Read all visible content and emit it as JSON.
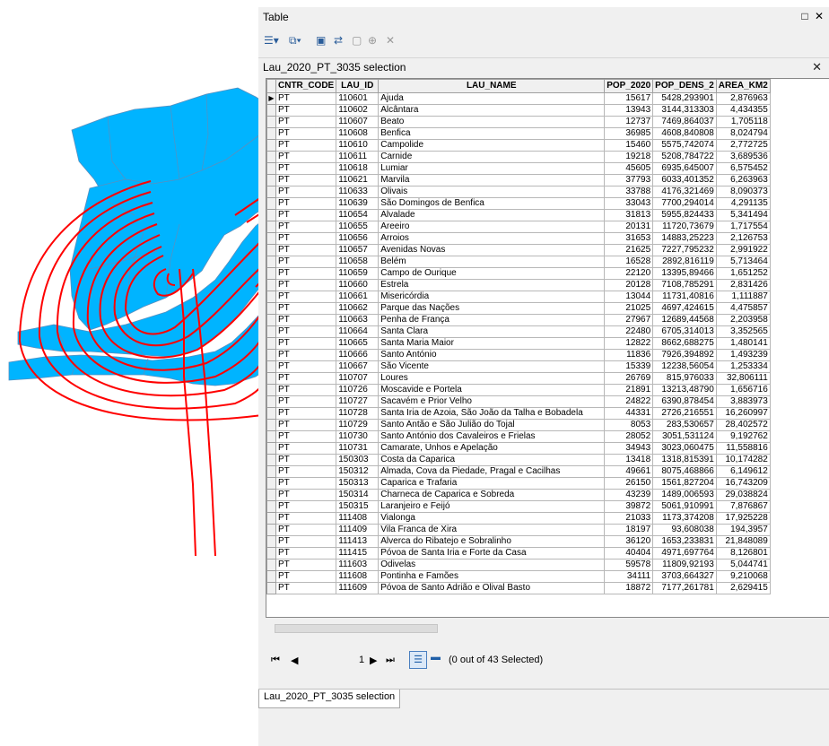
{
  "window": {
    "title": "Table",
    "close_glyph": "□ ✕"
  },
  "toolbar": {
    "icons": [
      "table-options-icon",
      "related-tables-icon",
      "select-by-attributes-icon",
      "switch-selection-icon",
      "clear-selection-icon",
      "zoom-to-selected-icon",
      "delete-selected-icon"
    ]
  },
  "tab": {
    "label": "Lau_2020_PT_3035 selection",
    "close": "✕"
  },
  "bottom_tab": {
    "label": "Lau_2020_PT_3035 selection"
  },
  "nav": {
    "first": "⏮",
    "prev": "◀",
    "current": "1",
    "next": "▶",
    "last": "⏭",
    "status": "(0 out of 43 Selected)"
  },
  "colors": {
    "map_fill": "#00b4ff",
    "contour": "#ff0000",
    "map_border": "#5a8fbf"
  },
  "table": {
    "columns": [
      "CNTR_CODE",
      "LAU_ID",
      "LAU_NAME",
      "POP_2020",
      "POP_DENS_2",
      "AREA_KM2"
    ],
    "rows": [
      [
        "PT",
        "110601",
        "Ajuda",
        "15617",
        "5428,293901",
        "2,876963"
      ],
      [
        "PT",
        "110602",
        "Alcântara",
        "13943",
        "3144,313303",
        "4,434355"
      ],
      [
        "PT",
        "110607",
        "Beato",
        "12737",
        "7469,864037",
        "1,705118"
      ],
      [
        "PT",
        "110608",
        "Benfica",
        "36985",
        "4608,840808",
        "8,024794"
      ],
      [
        "PT",
        "110610",
        "Campolide",
        "15460",
        "5575,742074",
        "2,772725"
      ],
      [
        "PT",
        "110611",
        "Carnide",
        "19218",
        "5208,784722",
        "3,689536"
      ],
      [
        "PT",
        "110618",
        "Lumiar",
        "45605",
        "6935,645007",
        "6,575452"
      ],
      [
        "PT",
        "110621",
        "Marvila",
        "37793",
        "6033,401352",
        "6,263963"
      ],
      [
        "PT",
        "110633",
        "Olivais",
        "33788",
        "4176,321469",
        "8,090373"
      ],
      [
        "PT",
        "110639",
        "São Domingos de Benfica",
        "33043",
        "7700,294014",
        "4,291135"
      ],
      [
        "PT",
        "110654",
        "Alvalade",
        "31813",
        "5955,824433",
        "5,341494"
      ],
      [
        "PT",
        "110655",
        "Areeiro",
        "20131",
        "11720,73679",
        "1,717554"
      ],
      [
        "PT",
        "110656",
        "Arroios",
        "31653",
        "14883,25223",
        "2,126753"
      ],
      [
        "PT",
        "110657",
        "Avenidas Novas",
        "21625",
        "7227,795232",
        "2,991922"
      ],
      [
        "PT",
        "110658",
        "Belém",
        "16528",
        "2892,816119",
        "5,713464"
      ],
      [
        "PT",
        "110659",
        "Campo de Ourique",
        "22120",
        "13395,89466",
        "1,651252"
      ],
      [
        "PT",
        "110660",
        "Estrela",
        "20128",
        "7108,785291",
        "2,831426"
      ],
      [
        "PT",
        "110661",
        "Misericórdia",
        "13044",
        "11731,40816",
        "1,111887"
      ],
      [
        "PT",
        "110662",
        "Parque das Nações",
        "21025",
        "4697,424615",
        "4,475857"
      ],
      [
        "PT",
        "110663",
        "Penha de França",
        "27967",
        "12689,44568",
        "2,203958"
      ],
      [
        "PT",
        "110664",
        "Santa Clara",
        "22480",
        "6705,314013",
        "3,352565"
      ],
      [
        "PT",
        "110665",
        "Santa Maria Maior",
        "12822",
        "8662,688275",
        "1,480141"
      ],
      [
        "PT",
        "110666",
        "Santo António",
        "11836",
        "7926,394892",
        "1,493239"
      ],
      [
        "PT",
        "110667",
        "São Vicente",
        "15339",
        "12238,56054",
        "1,253334"
      ],
      [
        "PT",
        "110707",
        "Loures",
        "26769",
        "815,976033",
        "32,806111"
      ],
      [
        "PT",
        "110726",
        "Moscavide e Portela",
        "21891",
        "13213,48790",
        "1,656716"
      ],
      [
        "PT",
        "110727",
        "Sacavém e Prior Velho",
        "24822",
        "6390,878454",
        "3,883973"
      ],
      [
        "PT",
        "110728",
        "Santa Iria de Azoia, São João da Talha e Bobadela",
        "44331",
        "2726,216551",
        "16,260997"
      ],
      [
        "PT",
        "110729",
        "Santo Antão e São Julião do Tojal",
        "8053",
        "283,530657",
        "28,402572"
      ],
      [
        "PT",
        "110730",
        "Santo António dos Cavaleiros e Frielas",
        "28052",
        "3051,531124",
        "9,192762"
      ],
      [
        "PT",
        "110731",
        "Camarate, Unhos e Apelação",
        "34943",
        "3023,060475",
        "11,558816"
      ],
      [
        "PT",
        "150303",
        "Costa da Caparica",
        "13418",
        "1318,815391",
        "10,174282"
      ],
      [
        "PT",
        "150312",
        "Almada, Cova da Piedade, Pragal e Cacilhas",
        "49661",
        "8075,468866",
        "6,149612"
      ],
      [
        "PT",
        "150313",
        "Caparica e Trafaria",
        "26150",
        "1561,827204",
        "16,743209"
      ],
      [
        "PT",
        "150314",
        "Charneca de Caparica e Sobreda",
        "43239",
        "1489,006593",
        "29,038824"
      ],
      [
        "PT",
        "150315",
        "Laranjeiro e Feijó",
        "39872",
        "5061,910991",
        "7,876867"
      ],
      [
        "PT",
        "111408",
        "Vialonga",
        "21033",
        "1173,374208",
        "17,925228"
      ],
      [
        "PT",
        "111409",
        "Vila Franca de Xira",
        "18197",
        "93,608038",
        "194,3957"
      ],
      [
        "PT",
        "111413",
        "Alverca do Ribatejo e Sobralinho",
        "36120",
        "1653,233831",
        "21,848089"
      ],
      [
        "PT",
        "111415",
        "Póvoa de Santa Iria e Forte da Casa",
        "40404",
        "4971,697764",
        "8,126801"
      ],
      [
        "PT",
        "111603",
        "Odivelas",
        "59578",
        "11809,92193",
        "5,044741"
      ],
      [
        "PT",
        "111608",
        "Pontinha e Famões",
        "34111",
        "3703,664327",
        "9,210068"
      ],
      [
        "PT",
        "111609",
        "Póvoa de Santo Adrião e Olival Basto",
        "18872",
        "7177,261781",
        "2,629415"
      ]
    ]
  }
}
